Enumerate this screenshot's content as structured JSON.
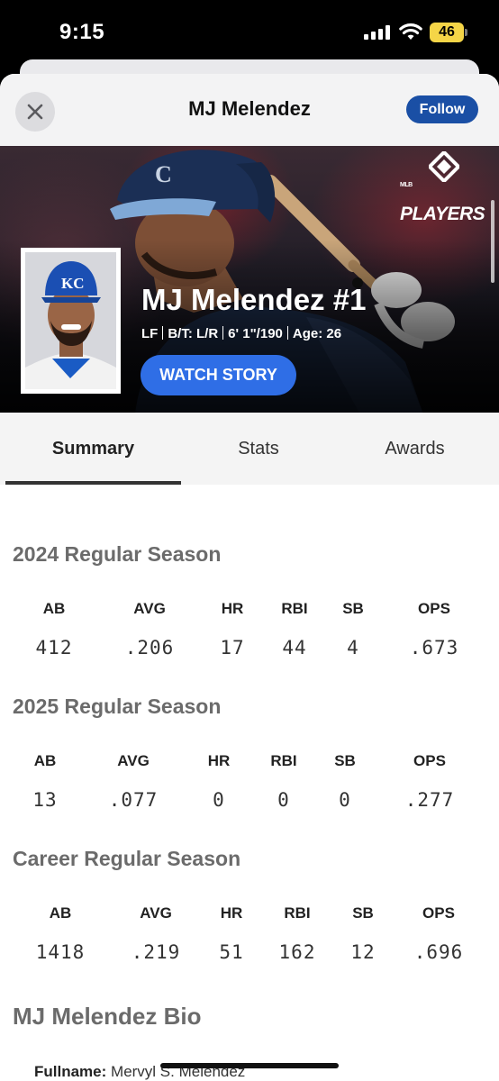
{
  "status_bar": {
    "time": "9:15",
    "battery": "46"
  },
  "header": {
    "title": "MJ Melendez",
    "follow_label": "Follow"
  },
  "hero": {
    "logo_text": "PLAYERS",
    "logo_small": "MLB",
    "player_name": "MJ Melendez #1",
    "position": "LF",
    "bats_throws": "B/T: L/R",
    "height_weight": "6' 1\"/190",
    "age": "Age: 26",
    "cap_logo": "KC",
    "watch_label": "WATCH STORY"
  },
  "tabs": [
    {
      "label": "Summary",
      "active": true
    },
    {
      "label": "Stats",
      "active": false
    },
    {
      "label": "Awards",
      "active": false
    }
  ],
  "seasons": [
    {
      "title": "2024 Regular Season",
      "headers": [
        "AB",
        "AVG",
        "HR",
        "RBI",
        "SB",
        "OPS"
      ],
      "values": [
        "412",
        ".206",
        "17",
        "44",
        "4",
        ".673"
      ]
    },
    {
      "title": "2025 Regular Season",
      "headers": [
        "AB",
        "AVG",
        "HR",
        "RBI",
        "SB",
        "OPS"
      ],
      "values": [
        "13",
        ".077",
        "0",
        "0",
        "0",
        ".277"
      ]
    },
    {
      "title": "Career Regular Season",
      "headers": [
        "AB",
        "AVG",
        "HR",
        "RBI",
        "SB",
        "OPS"
      ],
      "values": [
        "1418",
        ".219",
        "51",
        "162",
        "12",
        ".696"
      ]
    }
  ],
  "bio": {
    "title": "MJ Melendez Bio",
    "fullname_label": "Fullname:",
    "fullname_value": "Mervyl S. Melendez"
  },
  "colors": {
    "follow": "#1a4fa5",
    "watch": "#2f6ee6",
    "section_title": "#6b6b6b"
  }
}
